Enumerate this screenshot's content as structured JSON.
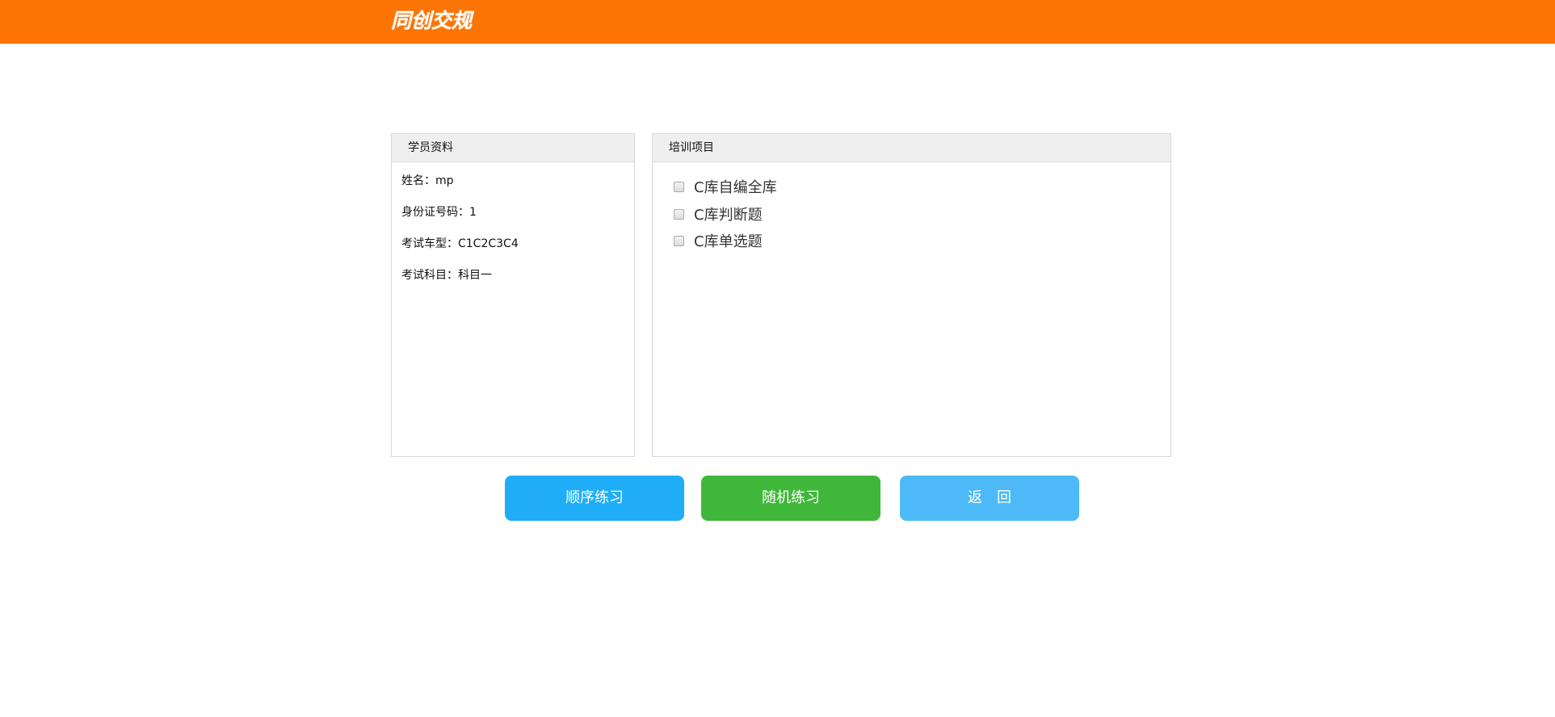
{
  "header": {
    "logo_text": "同创交规",
    "colors": {
      "background": "#fd7504",
      "text": "#ffffff"
    }
  },
  "student_panel": {
    "title": "学员资料",
    "name_line": "姓名：mp",
    "id_line": "身份证号码：1",
    "vehicle_line": "考试车型：C1C2C3C4",
    "subject_line": "考试科目：科目一"
  },
  "training_panel": {
    "title": "培训项目",
    "options": [
      {
        "label": "C库自编全库",
        "checked": false
      },
      {
        "label": "C库判断题",
        "checked": false
      },
      {
        "label": "C库单选题",
        "checked": false
      }
    ]
  },
  "actions": {
    "sequential_label": "顺序练习",
    "random_label": "随机练习",
    "back_label": "返　回",
    "colors": {
      "sequential": "#1fadf7",
      "random": "#40b73a",
      "back": "#4dbaf7"
    }
  }
}
